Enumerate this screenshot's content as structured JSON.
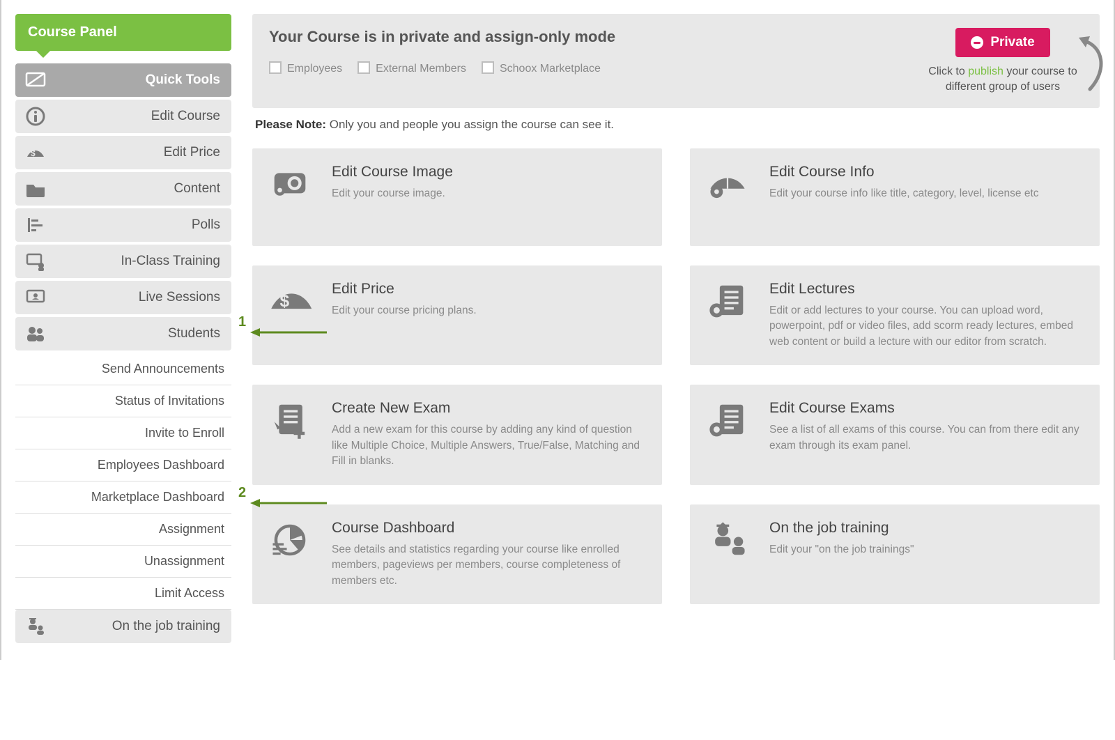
{
  "sidebar": {
    "title": "Course Panel",
    "items": [
      {
        "label": "Quick Tools",
        "icon": "board-icon",
        "active": true
      },
      {
        "label": "Edit Course",
        "icon": "info-icon"
      },
      {
        "label": "Edit Price",
        "icon": "pricebook-icon"
      },
      {
        "label": "Content",
        "icon": "folder-icon"
      },
      {
        "label": "Polls",
        "icon": "bars-icon"
      },
      {
        "label": "In-Class Training",
        "icon": "classroom-icon"
      },
      {
        "label": "Live Sessions",
        "icon": "screen-user-icon"
      },
      {
        "label": "Students",
        "icon": "students-icon"
      }
    ],
    "sub_items": [
      "Send Announcements",
      "Status of Invitations",
      "Invite to Enroll",
      "Employees Dashboard",
      "Marketplace Dashboard",
      "Assignment",
      "Unassignment",
      "Limit Access"
    ],
    "items_after": [
      {
        "label": "On the job training",
        "icon": "ojt-icon"
      }
    ]
  },
  "callouts": {
    "c1": "1",
    "c2": "2"
  },
  "notice": {
    "title": "Your Course is in private and assign-only mode",
    "checks": [
      "Employees",
      "External Members",
      "Schoox Marketplace"
    ],
    "button": "Private",
    "hint_prefix": "Click to ",
    "hint_link": "publish",
    "hint_suffix": " your course to different group of users"
  },
  "please_note": {
    "label": "Please Note:",
    "text": " Only you and people you assign the course can see it."
  },
  "cards": [
    {
      "title": "Edit Course Image",
      "desc": "Edit your course image.",
      "icon": "camera-gear-icon"
    },
    {
      "title": "Edit Course Info",
      "desc": "Edit your course info like title, category, level, license etc",
      "icon": "book-gear-icon"
    },
    {
      "title": "Edit Price",
      "desc": "Edit your course pricing plans.",
      "icon": "pricebook-lg-icon"
    },
    {
      "title": "Edit Lectures",
      "desc": "Edit or add lectures to your course. You can upload word, powerpoint, pdf or video files, add scorm ready lectures, embed web content or build a lecture with our editor from scratch.",
      "icon": "lectures-icon"
    },
    {
      "title": "Create New Exam",
      "desc": "Add a new exam for this course by adding any kind of question like Multiple Choice, Multiple Answers, True/False, Matching and Fill in blanks.",
      "icon": "new-exam-icon"
    },
    {
      "title": "Edit Course Exams",
      "desc": "See a list of all exams of this course. You can from there edit any exam through its exam panel.",
      "icon": "edit-exams-icon"
    },
    {
      "title": "Course Dashboard",
      "desc": "See details and statistics regarding your course like enrolled members, pageviews per members, course completeness of members etc.",
      "icon": "dashboard-icon"
    },
    {
      "title": "On the job training",
      "desc": "Edit your \"on the job trainings\"",
      "icon": "ojt-lg-icon"
    }
  ]
}
